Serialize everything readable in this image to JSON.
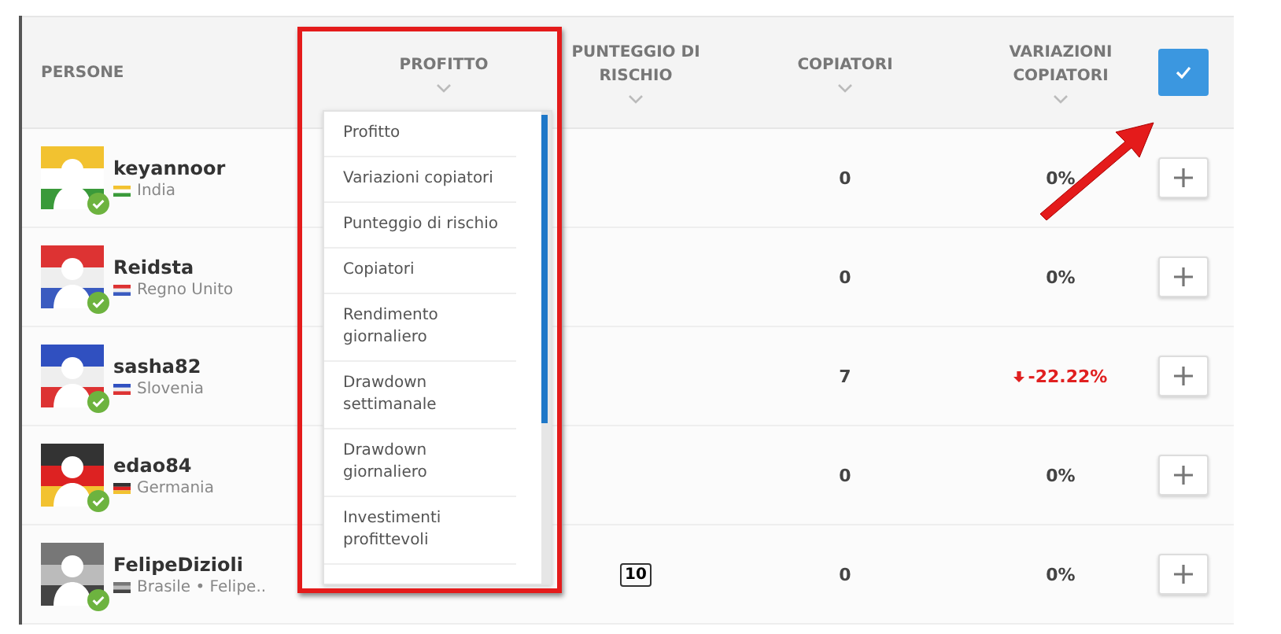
{
  "table": {
    "columns": [
      {
        "label": "PERSONE",
        "sortable": false
      },
      {
        "label": "PROFITTO",
        "sortable": true
      },
      {
        "label": "PUNTEGGIO DI RISCHIO",
        "sortable": true
      },
      {
        "label": "COPIATORI",
        "sortable": true
      },
      {
        "label": "VARIAZIONI COPIATORI",
        "sortable": true
      }
    ],
    "select_all": {
      "checked": true
    },
    "rows": [
      {
        "name": "keyannoor",
        "country": "India",
        "verified": true,
        "copiers": "0",
        "change": "0%",
        "kind": "neutral"
      },
      {
        "name": "Reidsta",
        "country": "Regno Unito",
        "verified": true,
        "copiers": "0",
        "change": "0%",
        "kind": "neutral"
      },
      {
        "name": "sasha82",
        "country": "Slovenia",
        "verified": true,
        "copiers": "7",
        "change": "-22.22%",
        "kind": "decrease"
      },
      {
        "name": "edao84",
        "country": "Germania",
        "verified": true,
        "copiers": "0",
        "change": "0%",
        "kind": "neutral"
      },
      {
        "name": "FelipeDizioli",
        "country": "Brasile • Felipe..",
        "verified": true,
        "risk_score": "10",
        "copiers": "0",
        "change": "0%",
        "kind": "neutral"
      }
    ]
  },
  "sort_menu": {
    "options": [
      {
        "label": "Profitto",
        "selected": false
      },
      {
        "label": "Variazioni copiatori",
        "selected": false
      },
      {
        "label": "Punteggio di rischio",
        "selected": false
      },
      {
        "label": "Copiatori",
        "selected": false
      },
      {
        "label": "Rendimento giornaliero",
        "selected": false
      },
      {
        "label": "Drawdown settimanale",
        "selected": false
      },
      {
        "label": "Drawdown giornaliero",
        "selected": false
      },
      {
        "label": "Investimenti profittevoli",
        "selected": false
      }
    ]
  }
}
